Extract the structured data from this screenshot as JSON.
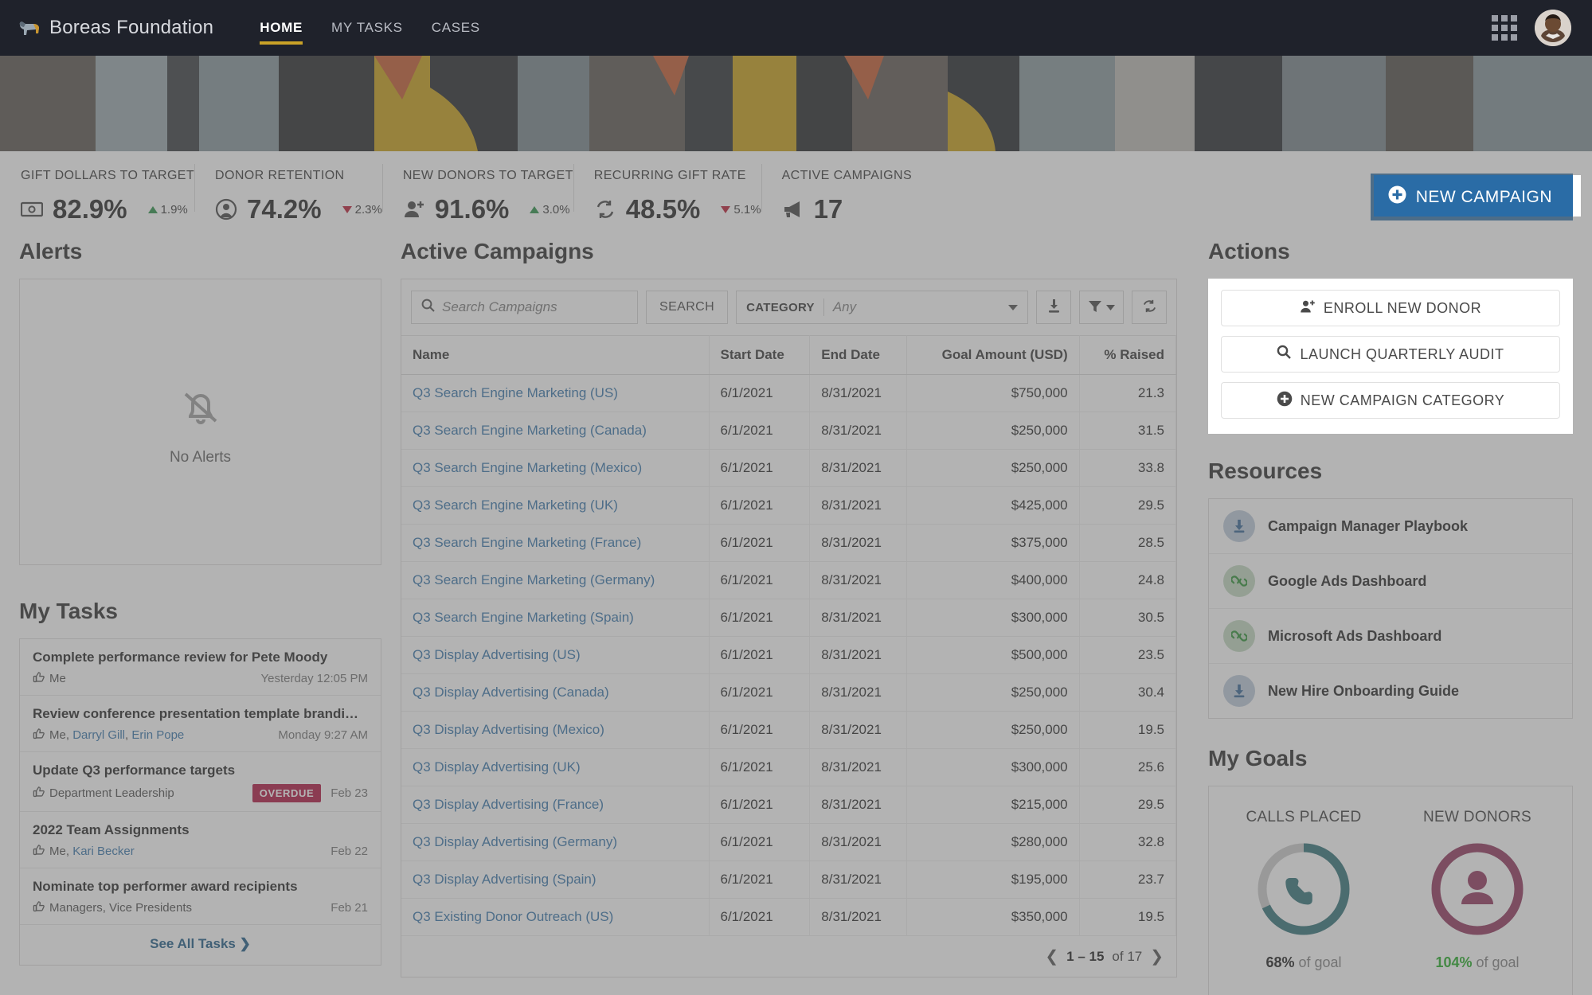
{
  "nav": {
    "brand": "Boreas Foundation",
    "brand_logo_icon": "bison-logo-icon",
    "tabs": [
      {
        "label": "HOME",
        "active": true
      },
      {
        "label": "MY TASKS",
        "active": false
      },
      {
        "label": "CASES",
        "active": false
      }
    ],
    "app_launcher_icon": "app-grid-icon",
    "avatar_icon": "user-avatar"
  },
  "banner": {
    "image": "king-penguins-photo"
  },
  "kpis": [
    {
      "label": "GIFT DOLLARS TO TARGET",
      "value": "82.9%",
      "delta": "1.9%",
      "dir": "up",
      "icon": "money-bill-icon"
    },
    {
      "label": "DONOR RETENTION",
      "value": "74.2%",
      "delta": "2.3%",
      "dir": "down",
      "icon": "user-circle-icon"
    },
    {
      "label": "NEW DONORS TO TARGET",
      "value": "91.6%",
      "delta": "3.0%",
      "dir": "up",
      "icon": "user-plus-icon"
    },
    {
      "label": "RECURRING GIFT RATE",
      "value": "48.5%",
      "delta": "5.1%",
      "dir": "down",
      "icon": "recurring-arrows-icon"
    },
    {
      "label": "ACTIVE CAMPAIGNS",
      "value": "17",
      "delta": "",
      "dir": "",
      "icon": "megaphone-icon"
    }
  ],
  "new_campaign_button": {
    "label": "NEW CAMPAIGN",
    "icon": "plus-circle-icon",
    "color": "#2a6ca6"
  },
  "alerts": {
    "title": "Alerts",
    "empty_text": "No Alerts",
    "empty_icon": "bell-slash-icon"
  },
  "my_tasks": {
    "title": "My Tasks",
    "see_all_label": "See All Tasks",
    "items": [
      {
        "title": "Complete performance review for Pete Moody",
        "people": "Me",
        "links": [],
        "date": "Yesterday 12:05 PM",
        "badge": ""
      },
      {
        "title": "Review conference presentation template brandi…",
        "people": "Me, ",
        "links": [
          "Darryl Gill",
          "Erin Pope"
        ],
        "date": "Monday 9:27 AM",
        "badge": ""
      },
      {
        "title": "Update Q3 performance targets",
        "people": "Department Leadership",
        "links": [],
        "date": "Feb 23",
        "badge": "OVERDUE"
      },
      {
        "title": "2022 Team Assignments",
        "people": "Me, ",
        "links": [
          "Kari Becker"
        ],
        "date": "Feb 22",
        "badge": ""
      },
      {
        "title": "Nominate top performer award recipients",
        "people": "Managers, Vice Presidents",
        "links": [],
        "date": "Feb 21",
        "badge": ""
      }
    ]
  },
  "campaigns": {
    "title": "Active Campaigns",
    "search": {
      "placeholder": "Search Campaigns",
      "value": "",
      "button_label": "SEARCH",
      "icon": "search-icon"
    },
    "category": {
      "label": "CATEGORY",
      "value": "Any"
    },
    "toolbar_icons": [
      "download-icon",
      "filter-icon",
      "refresh-icon"
    ],
    "columns": [
      "Name",
      "Start Date",
      "End Date",
      "Goal Amount (USD)",
      "% Raised"
    ],
    "rows": [
      [
        "Q3 Search Engine Marketing (US)",
        "6/1/2021",
        "8/31/2021",
        "$750,000",
        "21.3"
      ],
      [
        "Q3 Search Engine Marketing (Canada)",
        "6/1/2021",
        "8/31/2021",
        "$250,000",
        "31.5"
      ],
      [
        "Q3 Search Engine Marketing (Mexico)",
        "6/1/2021",
        "8/31/2021",
        "$250,000",
        "33.8"
      ],
      [
        "Q3 Search Engine Marketing (UK)",
        "6/1/2021",
        "8/31/2021",
        "$425,000",
        "29.5"
      ],
      [
        "Q3 Search Engine Marketing (France)",
        "6/1/2021",
        "8/31/2021",
        "$375,000",
        "28.5"
      ],
      [
        "Q3 Search Engine Marketing (Germany)",
        "6/1/2021",
        "8/31/2021",
        "$400,000",
        "24.8"
      ],
      [
        "Q3 Search Engine Marketing (Spain)",
        "6/1/2021",
        "8/31/2021",
        "$300,000",
        "30.5"
      ],
      [
        "Q3 Display Advertising (US)",
        "6/1/2021",
        "8/31/2021",
        "$500,000",
        "23.5"
      ],
      [
        "Q3 Display Advertising (Canada)",
        "6/1/2021",
        "8/31/2021",
        "$250,000",
        "30.4"
      ],
      [
        "Q3 Display Advertising (Mexico)",
        "6/1/2021",
        "8/31/2021",
        "$250,000",
        "19.5"
      ],
      [
        "Q3 Display Advertising (UK)",
        "6/1/2021",
        "8/31/2021",
        "$300,000",
        "25.6"
      ],
      [
        "Q3 Display Advertising (France)",
        "6/1/2021",
        "8/31/2021",
        "$215,000",
        "29.5"
      ],
      [
        "Q3 Display Advertising (Germany)",
        "6/1/2021",
        "8/31/2021",
        "$280,000",
        "32.8"
      ],
      [
        "Q3 Display Advertising (Spain)",
        "6/1/2021",
        "8/31/2021",
        "$195,000",
        "23.7"
      ],
      [
        "Q3 Existing Donor Outreach (US)",
        "6/1/2021",
        "8/31/2021",
        "$350,000",
        "19.5"
      ]
    ],
    "pagination": {
      "range": "1 – 15",
      "of_label": "of 17",
      "prev_icon": "chevron-left-icon",
      "next_icon": "chevron-right-icon"
    }
  },
  "actions": {
    "title": "Actions",
    "items": [
      {
        "label": "ENROLL NEW DONOR",
        "icon": "user-plus-icon"
      },
      {
        "label": "LAUNCH QUARTERLY AUDIT",
        "icon": "search-icon"
      },
      {
        "label": "NEW CAMPAIGN CATEGORY",
        "icon": "plus-circle-icon"
      }
    ]
  },
  "resources": {
    "title": "Resources",
    "items": [
      {
        "label": "Campaign Manager Playbook",
        "icon": "download-icon",
        "kind": "dl"
      },
      {
        "label": "Google Ads Dashboard",
        "icon": "link-icon",
        "kind": "link"
      },
      {
        "label": "Microsoft Ads Dashboard",
        "icon": "link-icon",
        "kind": "link"
      },
      {
        "label": "New Hire Onboarding Guide",
        "icon": "download-icon",
        "kind": "dl"
      }
    ]
  },
  "my_goals": {
    "title": "My Goals",
    "items": [
      {
        "label": "CALLS PLACED",
        "percent": 68,
        "percent_text": "68%",
        "suffix": "of goal",
        "icon": "phone-icon",
        "color": "#266b72",
        "over": false
      },
      {
        "label": "NEW DONORS",
        "percent": 104,
        "percent_text": "104%",
        "suffix": "of goal",
        "icon": "person-icon",
        "color": "#8d2a54",
        "over": true
      }
    ]
  }
}
